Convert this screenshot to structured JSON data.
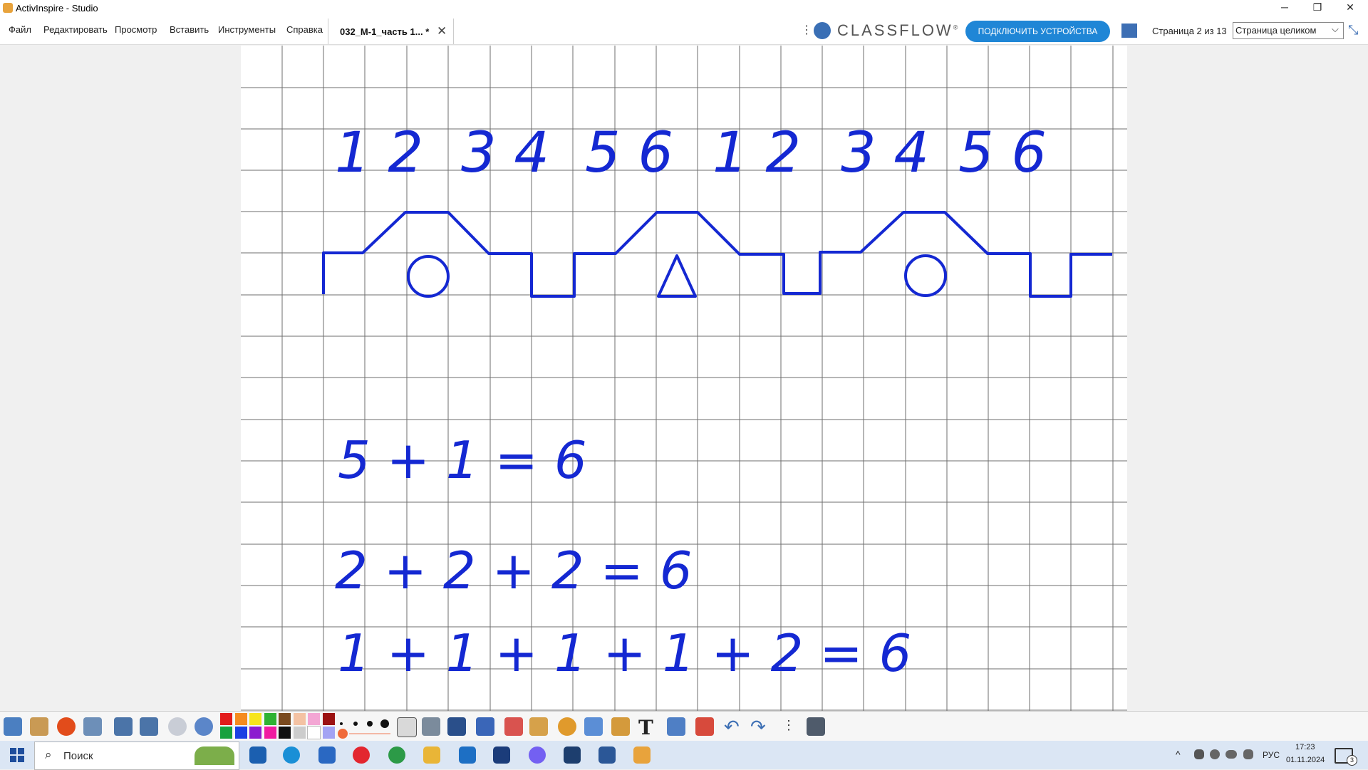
{
  "window": {
    "title": "ActivInspire - Studio",
    "minimize": "─",
    "restore": "❐",
    "close": "✕"
  },
  "menu": {
    "items": [
      "Файл",
      "Редактировать",
      "Просмотр",
      "Вставить",
      "Инструменты",
      "Справка"
    ]
  },
  "document_tab": {
    "label": "032_М-1_часть 1... *",
    "close": "✕"
  },
  "header": {
    "more_icon": "⋮",
    "brand": "CLASSFLOW",
    "brand_mark": "®",
    "connect_button": "ПОДКЛЮЧИТЬ УСТРОЙСТВА",
    "page_indicator": "Страница 2 из 13",
    "view_mode": "Страница целиком",
    "view_chevron": "⌵",
    "fullscreen_icon": "⤡"
  },
  "flipchart": {
    "digit_groups": [
      "1 2",
      "3 4",
      "5 6",
      "1 2",
      "3 4",
      "5 6"
    ],
    "equations": [
      "5 + 1 = 6",
      "2 + 2 + 2 = 6",
      "1 + 1 + 1 + 1 + 2 = 6"
    ],
    "ink_color": "#1428d2",
    "grid_color": "#6e6e6e"
  },
  "toolbar": {
    "palette": [
      "#e31b1b",
      "#f58b1f",
      "#f7e51c",
      "#2fb233",
      "#7a4a1f",
      "#f4c2a3",
      "#f3a6d4",
      "#9b1212",
      "#18a13e",
      "#1b3fe3",
      "#8c1ccf",
      "#f01ba1",
      "#111111",
      "#cccccc",
      "#ffffff",
      "#a3a3f3"
    ],
    "text_tool": "T",
    "more_icon": "⋮",
    "undo": "↶",
    "redo": "↷"
  },
  "taskbar": {
    "search_placeholder": "Поиск",
    "search_icon": "⌕",
    "language": "РУС",
    "time": "17:23",
    "date": "01.11.2024",
    "notifications": "3",
    "tray_chevron": "^"
  }
}
